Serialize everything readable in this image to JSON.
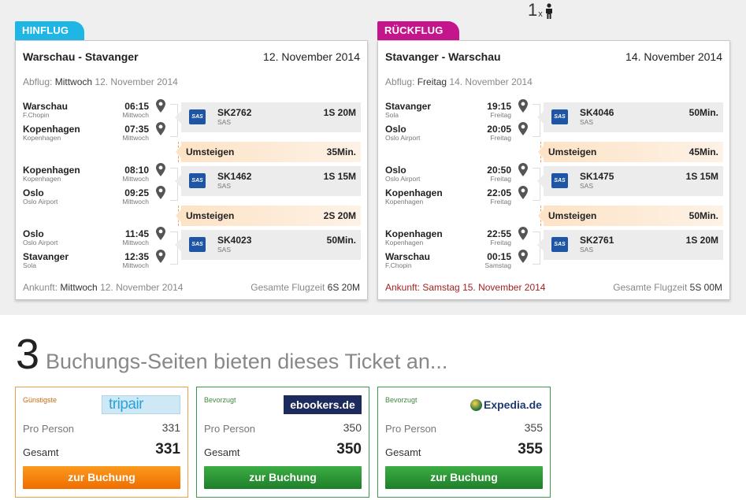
{
  "passengers": {
    "count": "1",
    "multiplier": "x",
    "icon": "person-icon"
  },
  "outbound": {
    "tab": "HINFLUG",
    "tab_color": "#1fb6e6",
    "route": "Warschau - Stavanger",
    "date": "12. November 2014",
    "departure_label": "Abflug:",
    "departure_day": "Mittwoch",
    "departure_date": "12. November 2014",
    "segments": [
      {
        "from_city": "Warschau",
        "from_airport": "F.Chopin",
        "dep_time": "06:15",
        "dep_day": "Mittwoch",
        "to_city": "Kopenhagen",
        "to_airport": "Kopenhagen",
        "arr_time": "07:35",
        "arr_day": "Mittwoch",
        "flight": "SK2762",
        "carrier": "SAS",
        "duration": "1S 20M"
      },
      {
        "from_city": "Kopenhagen",
        "from_airport": "Kopenhagen",
        "dep_time": "08:10",
        "dep_day": "Mittwoch",
        "to_city": "Oslo",
        "to_airport": "Oslo Airport",
        "arr_time": "09:25",
        "arr_day": "Mittwoch",
        "flight": "SK1462",
        "carrier": "SAS",
        "duration": "1S 15M"
      },
      {
        "from_city": "Oslo",
        "from_airport": "Oslo Airport",
        "dep_time": "11:45",
        "dep_day": "Mittwoch",
        "to_city": "Stavanger",
        "to_airport": "Sola",
        "arr_time": "12:35",
        "arr_day": "Mittwoch",
        "flight": "SK4023",
        "carrier": "SAS",
        "duration": "50Min."
      }
    ],
    "layovers": [
      {
        "label": "Umsteigen",
        "duration": "35Min."
      },
      {
        "label": "Umsteigen",
        "duration": "2S 20M"
      }
    ],
    "arrival_label": "Ankunft:",
    "arrival_day": "Mittwoch",
    "arrival_date": "12. November 2014",
    "total_label": "Gesamte Flugzeit",
    "total_time": "6S 20M"
  },
  "return": {
    "tab": "RÜCKFLUG",
    "tab_color": "#c4158c",
    "route": "Stavanger - Warschau",
    "date": "14. November 2014",
    "departure_label": "Abflug:",
    "departure_day": "Freitag",
    "departure_date": "14. November 2014",
    "segments": [
      {
        "from_city": "Stavanger",
        "from_airport": "Sola",
        "dep_time": "19:15",
        "dep_day": "Freitag",
        "to_city": "Oslo",
        "to_airport": "Oslo Airport",
        "arr_time": "20:05",
        "arr_day": "Freitag",
        "flight": "SK4046",
        "carrier": "SAS",
        "duration": "50Min."
      },
      {
        "from_city": "Oslo",
        "from_airport": "Oslo Airport",
        "dep_time": "20:50",
        "dep_day": "Freitag",
        "to_city": "Kopenhagen",
        "to_airport": "Kopenhagen",
        "arr_time": "22:05",
        "arr_day": "Freitag",
        "flight": "SK1475",
        "carrier": "SAS",
        "duration": "1S 15M"
      },
      {
        "from_city": "Kopenhagen",
        "from_airport": "Kopenhagen",
        "dep_time": "22:55",
        "dep_day": "Freitag",
        "to_city": "Warschau",
        "to_airport": "F.Chopin",
        "arr_time": "00:15",
        "arr_day": "Samstag",
        "flight": "SK2761",
        "carrier": "SAS",
        "duration": "1S 20M"
      }
    ],
    "layovers": [
      {
        "label": "Umsteigen",
        "duration": "45Min."
      },
      {
        "label": "Umsteigen",
        "duration": "50Min."
      }
    ],
    "arrival_label": "Ankunft:",
    "arrival_day": "Samstag",
    "arrival_date": "15. November 2014",
    "total_label": "Gesamte Flugzeit",
    "total_time": "5S 00M"
  },
  "booking": {
    "count": "3",
    "text": "Buchungs-Seiten bieten dieses Ticket an...",
    "offers": [
      {
        "tag": "Günstigste",
        "logo": "tripair",
        "per_person_label": "Pro Person",
        "per_person": "331",
        "total_label": "Gesamt",
        "total": "331",
        "button": "zur Buchung",
        "accent": "#f06d00"
      },
      {
        "tag": "Bevorzugt",
        "logo": "ebookers.de",
        "per_person_label": "Pro Person",
        "per_person": "350",
        "total_label": "Gesamt",
        "total": "350",
        "button": "zur Buchung",
        "accent": "#1e7f2a"
      },
      {
        "tag": "Bevorzugt",
        "logo": "Expedia.de",
        "per_person_label": "Pro Person",
        "per_person": "355",
        "total_label": "Gesamt",
        "total": "355",
        "button": "zur Buchung",
        "accent": "#1e7f2a"
      }
    ]
  },
  "colors": {
    "sas_blue": "#1e55a5",
    "layover": "#fde3c6",
    "arrival_red": "#a32222"
  }
}
